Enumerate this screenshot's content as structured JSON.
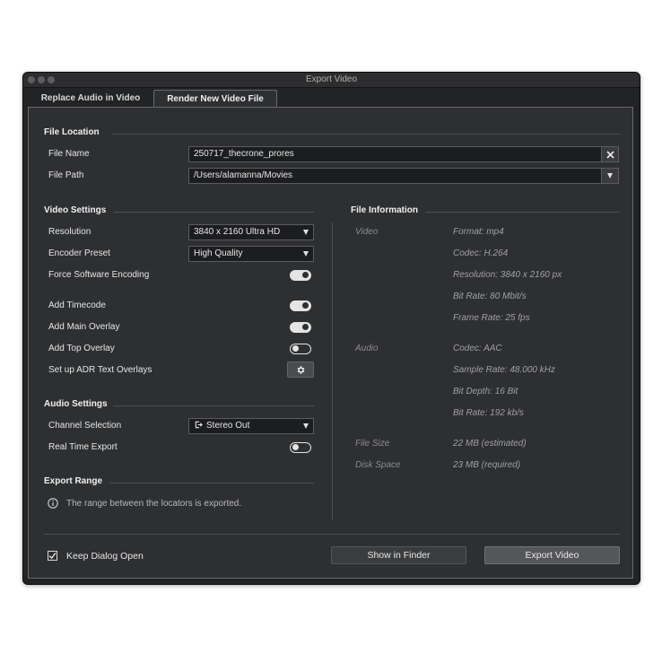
{
  "window": {
    "title": "Export Video"
  },
  "tabs": [
    {
      "label": "Replace Audio in Video",
      "active": false
    },
    {
      "label": "Render New Video File",
      "active": true
    }
  ],
  "file_location": {
    "title": "File Location",
    "file_name_label": "File Name",
    "file_name_value": "250717_thecrone_prores",
    "file_path_label": "File Path",
    "file_path_value": "/Users/alamanna/Movies"
  },
  "video_settings": {
    "title": "Video Settings",
    "resolution_label": "Resolution",
    "resolution_value": "3840 x 2160 Ultra HD",
    "encoder_label": "Encoder Preset",
    "encoder_value": "High Quality",
    "force_sw_label": "Force Software Encoding",
    "force_sw_on": true,
    "timecode_label": "Add Timecode",
    "timecode_on": true,
    "main_overlay_label": "Add Main Overlay",
    "main_overlay_on": true,
    "top_overlay_label": "Add Top Overlay",
    "top_overlay_on": false,
    "adr_label": "Set up ADR Text Overlays"
  },
  "audio_settings": {
    "title": "Audio Settings",
    "channel_label": "Channel Selection",
    "channel_value": "Stereo Out",
    "realtime_label": "Real Time Export",
    "realtime_on": false
  },
  "export_range": {
    "title": "Export Range",
    "info_text": "The range between the locators is exported."
  },
  "file_information": {
    "title": "File Information",
    "video_label": "Video",
    "video_format": "Format: mp4",
    "video_codec": "Codec: H.264",
    "video_resolution": "Resolution: 3840 x 2160 px",
    "video_bitrate": "Bit Rate: 80 Mbit/s",
    "video_framerate": "Frame Rate: 25 fps",
    "audio_label": "Audio",
    "audio_codec": "Codec: AAC",
    "audio_samplerate": "Sample Rate: 48.000 kHz",
    "audio_bitdepth": "Bit Depth: 16 Bit",
    "audio_bitrate": "Bit Rate: 192 kb/s",
    "file_size_label": "File Size",
    "file_size_value": "22 MB (estimated)",
    "disk_space_label": "Disk Space",
    "disk_space_value": "23 MB (required)"
  },
  "footer": {
    "keep_open_label": "Keep Dialog Open",
    "keep_open_checked": true,
    "show_finder_label": "Show in Finder",
    "export_label": "Export Video"
  },
  "icons": {
    "clear": "x-icon",
    "dropdown": "chevron-down-icon",
    "gear": "gear-icon",
    "output": "output-port-icon",
    "info": "info-icon",
    "check": "checkmark-icon"
  }
}
